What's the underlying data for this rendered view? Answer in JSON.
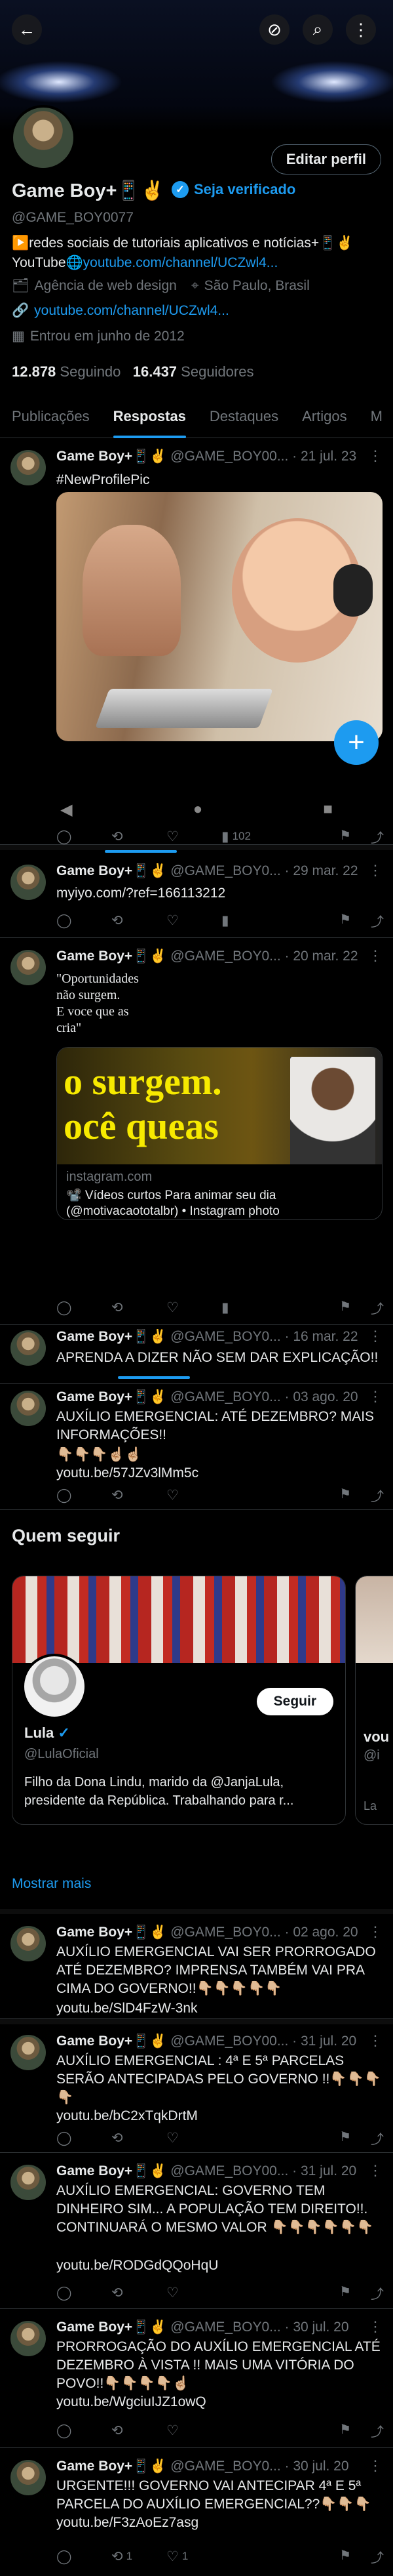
{
  "colors": {
    "accent": "#1d9bf0",
    "bg": "#000000",
    "muted": "#71767b"
  },
  "header": {
    "back_icon": "arrow-left-icon",
    "mute_icon": "mute-icon",
    "search_icon": "search-icon",
    "menu_icon": "more-vertical-icon",
    "back": "←",
    "mute": "⊘",
    "search": "⌕",
    "menu": "⋮"
  },
  "profile": {
    "name": "Game Boy+📱✌",
    "edit_label": "Editar perfil",
    "verify_label": "Seja verificado",
    "handle": "@GAME_BOY0077",
    "bio_1": "▶️redes sociais  de tutoriais aplicativos e notícias+📱✌",
    "bio_2_prefix": "YouTube🌐",
    "bio_2_link": "youtube.com/channel/UCZwl4...",
    "category": "Agência de web design",
    "location": "São Paulo, Brasil",
    "website": "youtube.com/channel/UCZwl4...",
    "joined": "Entrou em junho de 2012",
    "following_count": "12.878",
    "following_label": "Seguindo",
    "followers_count": "16.437",
    "followers_label": "Seguidores"
  },
  "tabs": [
    "Publicações",
    "Respostas",
    "Destaques",
    "Artigos",
    "M"
  ],
  "posts": [
    {
      "name": "Game Boy+📱✌",
      "meta": "@GAME_BOY00... · 21 jul. 23",
      "text": "#NewProfilePic",
      "reply": "",
      "retweet": "",
      "like": "",
      "views": "102"
    },
    {
      "name": "Game Boy+📱✌",
      "meta": "@GAME_BOY0... · 29 mar. 22",
      "text": "myiyo.com/?ref=166113212",
      "reply": "",
      "retweet": "",
      "like": "",
      "views": ""
    },
    {
      "name": "Game Boy+📱✌",
      "meta": "@GAME_BOY0... · 20 mar. 22",
      "text": "",
      "reply": "",
      "retweet": "",
      "like": "",
      "views": ""
    },
    {
      "name": "Game Boy+📱✌",
      "meta": "@GAME_BOY0... · 16 mar. 22",
      "text": "APRENDA A DIZER NÃO SEM DAR EXPLICAÇÃO!!",
      "reply": "",
      "retweet": "",
      "like": "",
      "views": ""
    },
    {
      "name": "Game Boy+📱✌",
      "meta": "@GAME_BOY0... · 03 ago. 20",
      "text": "AUXÍLIO EMERGENCIAL: ATÉ DEZEMBRO? MAIS INFORMAÇÕES!!",
      "emojis": "👇🏼👇🏼👇🏼☝🏼☝🏼",
      "link": "youtu.be/57JZv3lMm5c",
      "reply": "",
      "retweet": "",
      "like": "",
      "views": ""
    }
  ],
  "image_post": {
    "quote": "\"Oportunidades\nnão surgem.\nE voce que as\ncria\"",
    "card_line1": "o surgem.",
    "card_line2": "ocê queas",
    "domain": "instagram.com",
    "desc": "📽️ Vídeos curtos Para animar seu dia (@motivacaototalbr) • Instagram photo"
  },
  "who_to_follow": {
    "title": "Quem seguir",
    "name": "Lula",
    "handle": "@LulaOficial",
    "follow_label": "Seguir",
    "bio": "Filho da Dona Lindu, marido da @JanjaLula, presidente da República. Trabalhando para r...",
    "next_name": "vou",
    "next_handle": "@i",
    "next_bio": "La",
    "show_more": "Mostrar mais"
  },
  "posts_lower": [
    {
      "name": "Game Boy+📱✌",
      "meta": "@GAME_BOY0... · 02 ago. 20",
      "text": "AUXÍLIO EMERGENCIAL VAI SER PRORROGADO ATÉ DEZEMBRO? IMPRENSA TAMBÉM VAI PRA CIMA DO GOVERNO!!👇🏼👇🏼👇🏼👇🏼👇🏼",
      "link": "youtu.be/SlD4FzW-3nk",
      "reply": "",
      "retweet": "",
      "like": ""
    },
    {
      "name": "Game Boy+📱✌",
      "meta": "@GAME_BOY00... · 31 jul. 20",
      "text": "AUXÍLIO EMERGENCIAL : 4ª E 5ª PARCELAS SERÃO ANTECIPADAS PELO GOVERNO !!👇🏼👇🏼👇🏼👇🏼",
      "link": "youtu.be/bC2xTqkDrtM",
      "reply": "",
      "retweet": "",
      "like": ""
    },
    {
      "name": "Game Boy+📱✌",
      "meta": "@GAME_BOY00... · 31 jul. 20",
      "text": "AUXÍLIO EMERGENCIAL: GOVERNO TEM DINHEIRO SIM... A POPULAÇÃO TEM DIREITO!!. CONTINUARÁ O MESMO VALOR 👇🏼👇🏼👇🏼👇🏼👇🏼👇🏼",
      "link": "youtu.be/RODGdQQoHqU",
      "reply": "",
      "retweet": "",
      "like": ""
    },
    {
      "name": "Game Boy+📱✌",
      "meta": "@GAME_BOY0... · 30 jul. 20",
      "text": "PRORROGAÇÃO DO AUXÍLIO EMERGENCIAL ATÉ DEZEMBRO À VISTA !! MAIS UMA VITÓRIA DO POVO!!👇🏼👇🏼👇🏼👇🏼☝🏼",
      "link": "youtu.be/WgciuIJZ1owQ",
      "reply": "",
      "retweet": "",
      "like": ""
    },
    {
      "name": "Game Boy+📱✌",
      "meta": "@GAME_BOY0... · 30 jul. 20",
      "text": "URGENTE!!! GOVERNO VAI ANTECIPAR 4ª E 5ª PARCELA DO AUXÍLIO EMERGENCIAL??👇🏼👇🏼👇🏼",
      "link": "youtu.be/F3zAoEz7asg",
      "reply": "",
      "retweet": "1",
      "like": "1"
    }
  ]
}
